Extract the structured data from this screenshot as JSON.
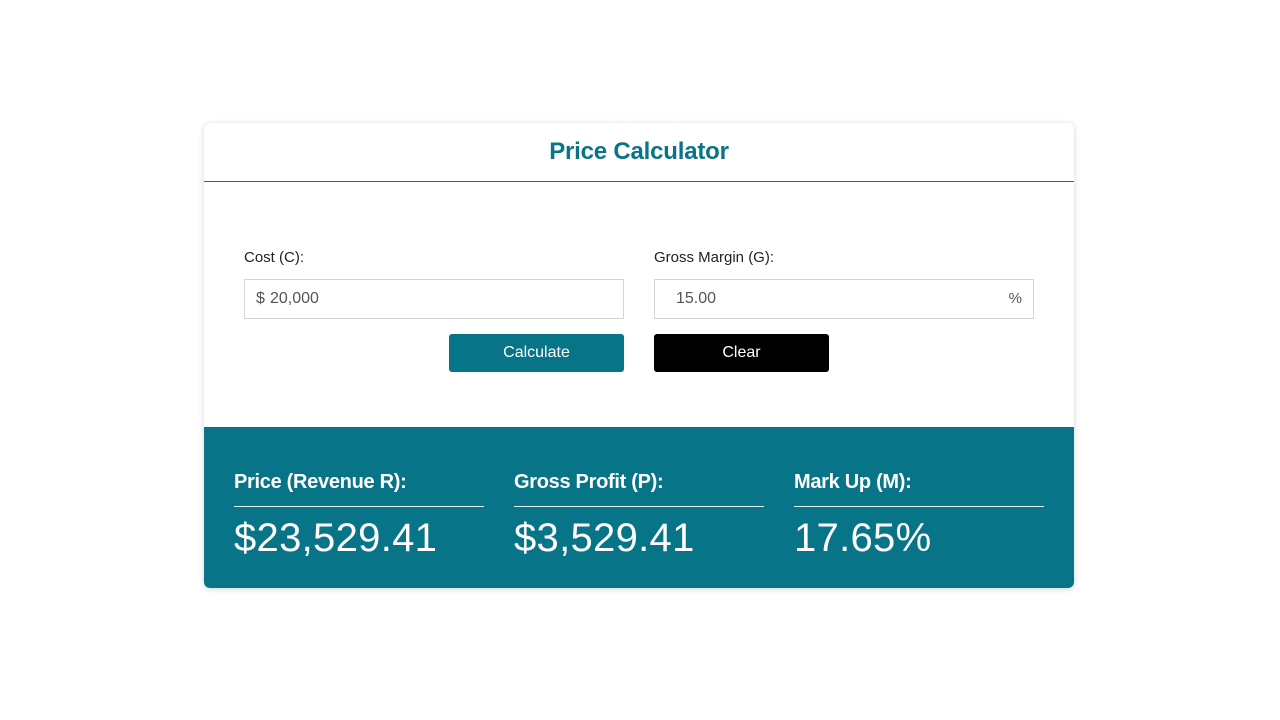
{
  "header": {
    "title": "Price Calculator"
  },
  "form": {
    "cost": {
      "label": "Cost (C):",
      "prefix": "$",
      "value": "20,000"
    },
    "margin": {
      "label": "Gross Margin (G):",
      "value": "15.00",
      "suffix": "%"
    },
    "buttons": {
      "calculate": "Calculate",
      "clear": "Clear"
    }
  },
  "results": [
    {
      "label": "Price (Revenue R):",
      "value": "$23,529.41"
    },
    {
      "label": "Gross Profit (P):",
      "value": "$3,529.41"
    },
    {
      "label": "Mark Up (M):",
      "value": "17.65%"
    }
  ],
  "colors": {
    "accent": "#087487",
    "clear_button": "#000000",
    "background": "#ffffff"
  }
}
